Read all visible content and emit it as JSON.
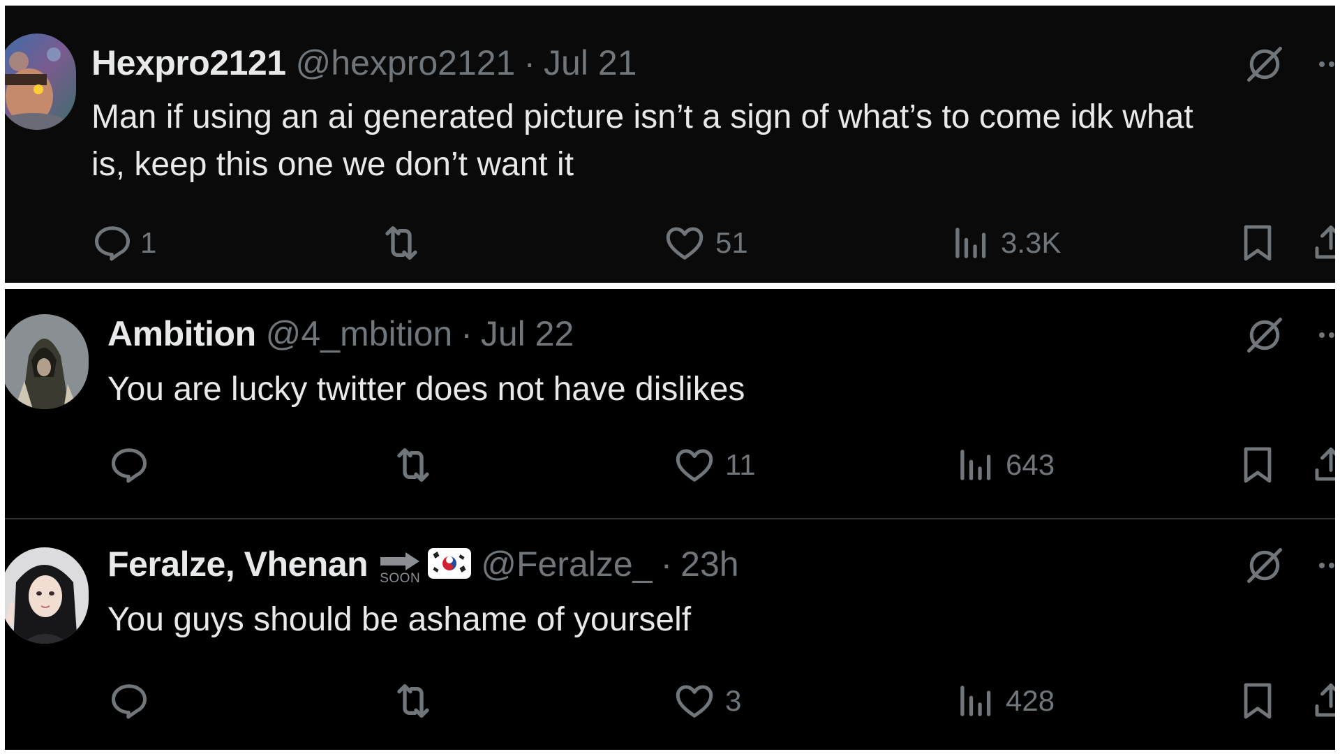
{
  "tweets": [
    {
      "display_name": "Hexpro2121",
      "handle": "@hexpro2121",
      "separator": "·",
      "date": "Jul 21",
      "text": "Man if using an ai generated picture isn’t a sign of what’s to come idk what\nis, keep this one we don’t want it",
      "replies": "1",
      "retweets": "",
      "likes": "51",
      "views": "3.3K"
    },
    {
      "display_name": "Ambition",
      "handle": "@4_mbition",
      "separator": "·",
      "date": "Jul 22",
      "text": "You are lucky twitter does not have dislikes",
      "replies": "",
      "retweets": "",
      "likes": "11",
      "views": "643"
    },
    {
      "display_name": "Feralze, Vhenan",
      "badge_text": "SOON",
      "handle": "@Feralze_",
      "separator": "·",
      "date": "23h",
      "text": "You guys should be ashame of yourself",
      "replies": "",
      "retweets": "",
      "likes": "3",
      "views": "428"
    }
  ],
  "icons": {
    "grok": "grok-icon",
    "more": "more-icon",
    "reply": "reply-icon",
    "retweet": "retweet-icon",
    "like": "heart-icon",
    "views": "views-icon",
    "bookmark": "bookmark-icon",
    "share": "share-icon",
    "flag": "south-korea-flag-icon",
    "badge": "arrow-right-icon"
  },
  "colors": {
    "background": "#000000",
    "text_primary": "#e7e9ea",
    "text_secondary": "#71767b",
    "divider": "#2f3336"
  }
}
